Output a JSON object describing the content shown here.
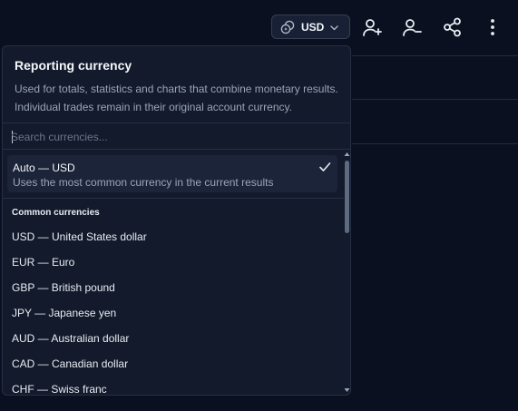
{
  "toolbar": {
    "currency_label": "USD",
    "icons": [
      "coins-icon",
      "chevron-down-icon",
      "add-user-icon",
      "remove-user-icon",
      "share-icon",
      "more-vertical-icon"
    ]
  },
  "dropdown": {
    "title": "Reporting currency",
    "description": "Used for totals, statistics and charts that combine monetary results. Individual trades remain in their original account currency.",
    "search": {
      "placeholder": "Search currencies...",
      "value": ""
    },
    "auto_option": {
      "name": "Auto — USD",
      "description": "Uses the most common currency in the current results",
      "selected": true
    },
    "section_title": "Common currencies",
    "currencies": [
      {
        "label": "USD — United States dollar"
      },
      {
        "label": "EUR — Euro"
      },
      {
        "label": "GBP — British pound"
      },
      {
        "label": "JPY — Japanese yen"
      },
      {
        "label": "AUD — Australian dollar"
      },
      {
        "label": "CAD — Canadian dollar"
      },
      {
        "label": "CHF — Swiss franc"
      }
    ]
  },
  "colors": {
    "background": "#0b1020",
    "panel": "#121a2b",
    "border": "#263045",
    "text_primary": "#e8ecf2",
    "text_secondary": "#9aa5b8"
  }
}
